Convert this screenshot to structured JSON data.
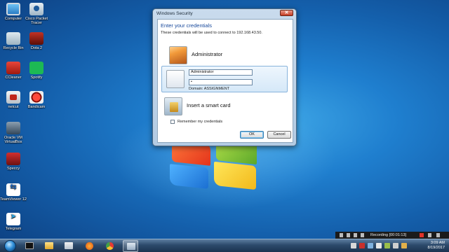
{
  "desktop": {
    "icons": [
      {
        "label": "Computer",
        "icon": "computer-icon"
      },
      {
        "label": "Cisco Packet Tracer",
        "icon": "cisco-packet-tracer-icon"
      },
      {
        "label": "Recycle Bin",
        "icon": "recycle-bin-icon"
      },
      {
        "label": "Dota 2",
        "icon": "dota2-icon"
      },
      {
        "label": "CCleaner",
        "icon": "ccleaner-icon"
      },
      {
        "label": "Spotify",
        "icon": "spotify-icon"
      },
      {
        "label": "netcut",
        "icon": "netcut-icon"
      },
      {
        "label": "Bandicam",
        "icon": "bandicam-icon"
      },
      {
        "label": "Oracle VM VirtualBox",
        "icon": "virtualbox-icon"
      },
      {
        "label": "Speccy",
        "icon": "speccy-icon"
      },
      {
        "label": "TeamViewer 12",
        "icon": "teamviewer-icon"
      },
      {
        "label": "Telegram",
        "icon": "telegram-icon"
      }
    ]
  },
  "dialog": {
    "window_title": "Windows Security",
    "close_glyph": "✕",
    "heading": "Enter your credentials",
    "subtitle": "These credentials will be used to connect to 192.168.43.50.",
    "accounts": {
      "saved_user": "Administrator",
      "smart_card": "Insert a smart card"
    },
    "username_value": "Administrator",
    "password_value": "•",
    "domain": "Domain: ASSIGNMENT",
    "remember_label": "Remember my credentials",
    "remember_checked": false,
    "ok_label": "OK",
    "cancel_label": "Cancel"
  },
  "taskbar": {
    "items": [
      "cmd-icon",
      "explorer-icon",
      "firefox-icon",
      "chrome-icon",
      "windows-security-icon"
    ],
    "recording_text": "Recording [00:01:13]",
    "time": "3:09 AM",
    "date": "8/19/2017"
  },
  "colors": {
    "desktop_blue": "#1f7fcf",
    "heading_blue": "#17489b",
    "selection": "#d5e8f8"
  }
}
